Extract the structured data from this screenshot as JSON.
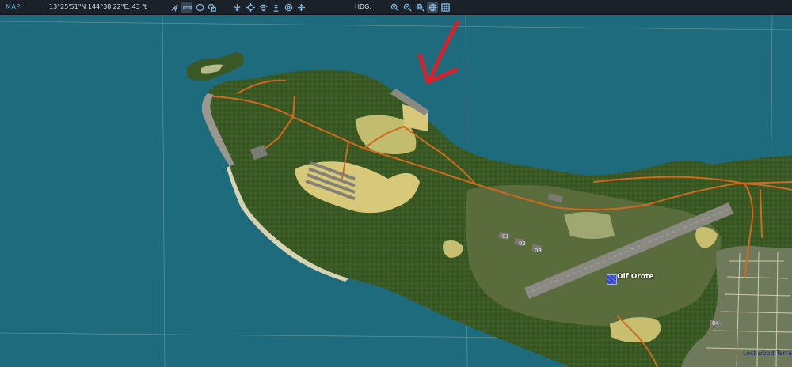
{
  "toolbar": {
    "title": "MAP",
    "coordinates": "13°25'51\"N 144°38'22\"E, 43 ft",
    "hdg_label": "HDG:",
    "tools": [
      {
        "name": "navigation-arrow-icon"
      },
      {
        "name": "ruler-icon",
        "active": true
      },
      {
        "name": "circle-icon"
      },
      {
        "name": "layers-icon"
      },
      {
        "name": "aircraft-icon"
      },
      {
        "name": "crosshair-icon"
      },
      {
        "name": "signal-icon"
      },
      {
        "name": "tower-icon"
      },
      {
        "name": "target-icon"
      },
      {
        "name": "cross-move-icon"
      }
    ],
    "zoom_tools": [
      {
        "name": "zoom-in-icon"
      },
      {
        "name": "zoom-out-icon"
      },
      {
        "name": "zoom-fit-icon"
      },
      {
        "name": "globe-icon",
        "active": true
      },
      {
        "name": "grid-icon"
      }
    ]
  },
  "map": {
    "airfield_name": "Olf Orote",
    "runway_markers": [
      "01",
      "02",
      "03",
      "04"
    ],
    "town_label": "Lockwood Terrace",
    "annotation": "red-arrow"
  },
  "colors": {
    "sea": "#1d6b7d",
    "forest": "#3b5a24",
    "grass": "#5a6e3a",
    "sand": "#d8c97a",
    "road": "#d06a1e",
    "runway": "#8a8a82",
    "annotation": "#d9212a"
  }
}
